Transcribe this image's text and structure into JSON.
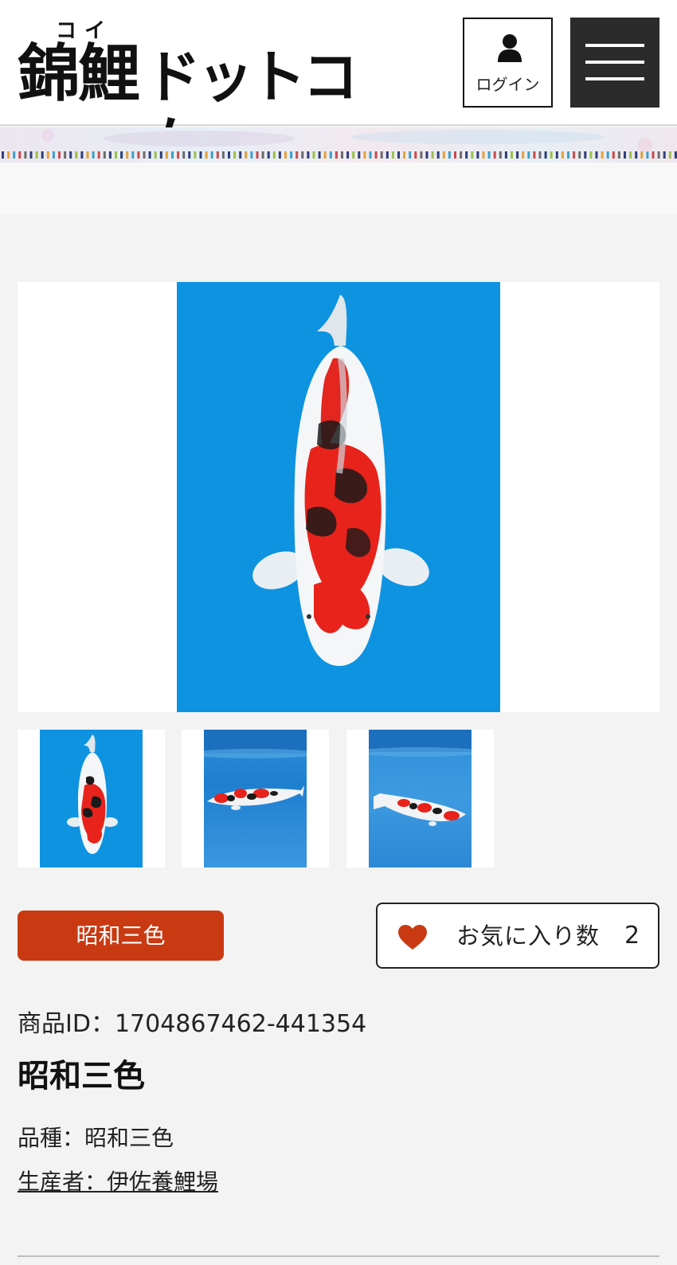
{
  "header": {
    "logo_ruby": "コイ",
    "logo_kanji": "錦鯉",
    "logo_kana": "ドットコム",
    "login_label": "ログイン",
    "login_icon": "user-icon",
    "menu_icon": "hamburger-menu-icon"
  },
  "gallery": {
    "main_image_bg": "#0e93e0",
    "thumbnails": [
      "koi-top-view",
      "koi-in-bowl-side",
      "koi-in-bowl-angle"
    ]
  },
  "product": {
    "variety_badge": "昭和三色",
    "favorites_label": "お気に入り数",
    "favorites_count": "2",
    "favorites_icon": "heart-icon",
    "id_line": "商品ID：1704867462-441354",
    "title": "昭和三色",
    "variety_line": "品種：昭和三色",
    "breeder_line": "生産者：伊佐養鯉場"
  },
  "colors": {
    "accent": "#c93a12",
    "menu_bg": "#2b2b2b",
    "background": "#f3f3f3"
  }
}
